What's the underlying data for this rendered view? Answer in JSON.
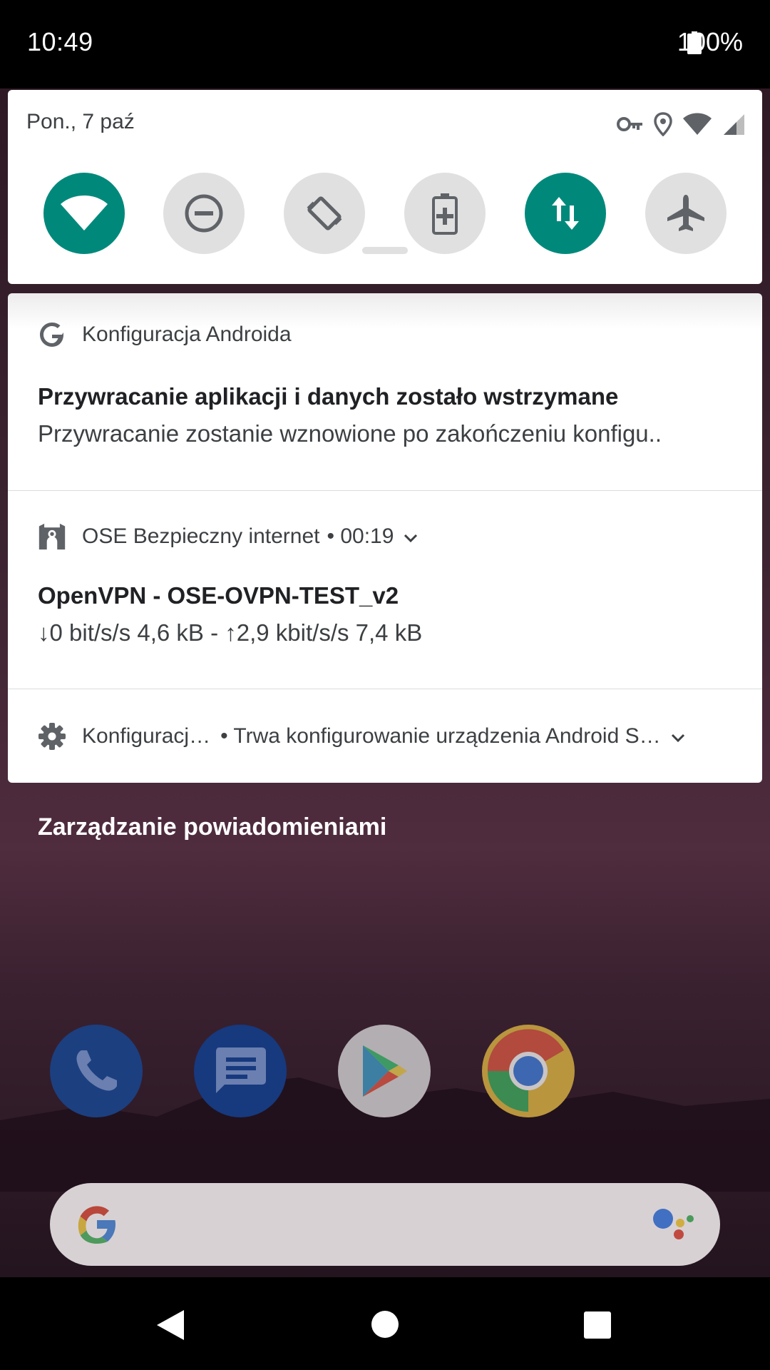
{
  "status_bar": {
    "time": "10:49",
    "battery_percent": "100%",
    "battery_icon": "battery-full-icon"
  },
  "quick_settings": {
    "date": "Pon., 7 paź",
    "status_icons": [
      "vpn-key-icon",
      "location-icon",
      "wifi-signal-icon",
      "cell-signal-icon"
    ],
    "tiles": [
      {
        "name": "wifi-icon",
        "state": "on"
      },
      {
        "name": "do-not-disturb-icon",
        "state": "off"
      },
      {
        "name": "auto-rotate-icon",
        "state": "off"
      },
      {
        "name": "battery-saver-icon",
        "state": "off"
      },
      {
        "name": "mobile-data-icon",
        "state": "on"
      },
      {
        "name": "airplane-mode-icon",
        "state": "off"
      }
    ],
    "accent_color": "#00897b"
  },
  "notifications": [
    {
      "app": "Konfiguracja Androida",
      "app_icon": "google-g-icon",
      "title": "Przywracanie aplikacji i danych zostało wstrzymane",
      "text": "Przywracanie zostanie wznowione po zakończeniu konfigu.."
    },
    {
      "app": "OSE Bezpieczny internet",
      "app_icon": "ose-shield-icon",
      "time": "• 00:19",
      "title": "OpenVPN - OSE-OVPN-TEST_v2",
      "text": "↓0 bit/s/s 4,6 kB - ↑2,9 kbit/s/s 7,4 kB"
    },
    {
      "app": "Konfiguracj…",
      "app_icon": "gear-icon",
      "text": "• Trwa konfigurowanie urządzenia Android S…"
    }
  ],
  "manage_notifications": "Zarządzanie powiadomieniami",
  "dock": [
    "phone-app-icon",
    "messages-app-icon",
    "play-store-icon",
    "chrome-icon"
  ],
  "search_bar": {
    "left_icon": "google-g-icon",
    "right_icon": "assistant-icon"
  },
  "nav_bar": [
    "back-icon",
    "home-icon",
    "recents-icon"
  ]
}
